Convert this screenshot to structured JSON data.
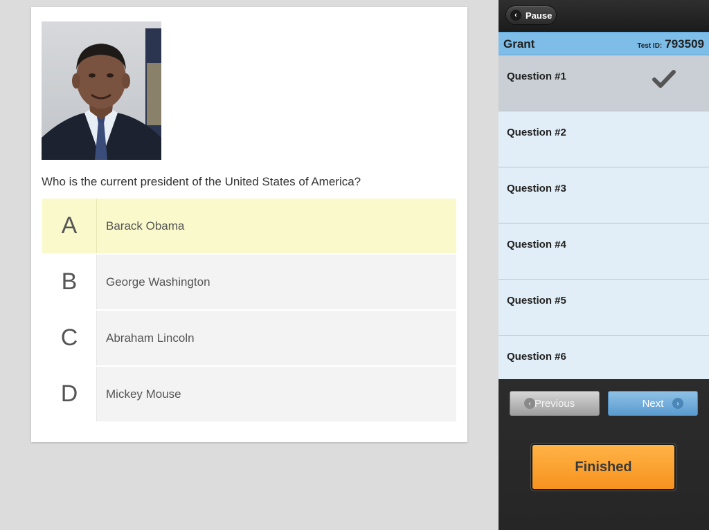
{
  "question": {
    "text": "Who is the current president of the United States of America?",
    "image_alt": "portrait photo",
    "answers": [
      {
        "letter": "A",
        "text": "Barack Obama",
        "selected": true
      },
      {
        "letter": "B",
        "text": "George Washington",
        "selected": false
      },
      {
        "letter": "C",
        "text": "Abraham Lincoln",
        "selected": false
      },
      {
        "letter": "D",
        "text": "Mickey Mouse",
        "selected": false
      }
    ]
  },
  "panel": {
    "pause_label": "Pause",
    "student_name": "Grant",
    "test_id_label": "Test ID:",
    "test_id": "793509",
    "questions": [
      {
        "label": "Question #1",
        "answered": true,
        "current": true
      },
      {
        "label": "Question #2",
        "answered": false,
        "current": false
      },
      {
        "label": "Question #3",
        "answered": false,
        "current": false
      },
      {
        "label": "Question #4",
        "answered": false,
        "current": false
      },
      {
        "label": "Question #5",
        "answered": false,
        "current": false
      },
      {
        "label": "Question #6",
        "answered": false,
        "current": false
      }
    ],
    "previous_label": "Previous",
    "next_label": "Next",
    "finished_label": "Finished"
  },
  "colors": {
    "selected_answer": "#f9f9cb",
    "name_bar": "#7dbde8",
    "finished_button": "#f7921e",
    "next_button": "#5a9bd0"
  },
  "icons": {
    "pause": "chevron-left-icon",
    "answered": "checkmark-icon",
    "previous": "chevron-left-icon",
    "next": "chevron-right-icon"
  }
}
